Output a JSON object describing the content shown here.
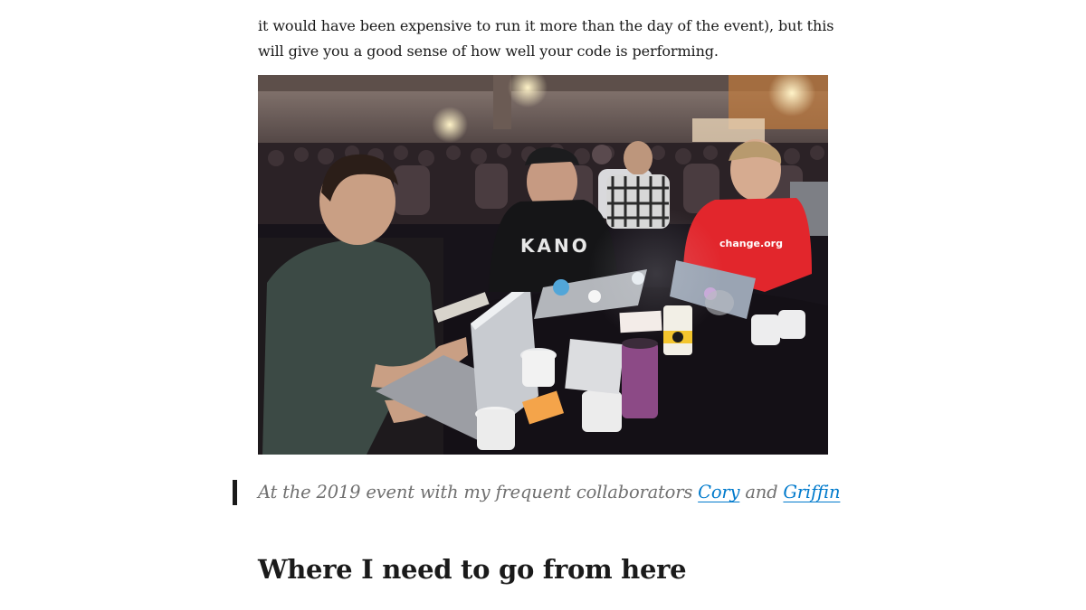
{
  "article": {
    "paragraph_lines": [
      "it would have been expensive to run it more than the day of the event), but this",
      "will give you a good sense of how well your code is performing."
    ],
    "photo": {
      "shirt_text_left": "KANO",
      "shirt_text_right": "change.org"
    },
    "caption": {
      "prefix": "At the 2019 event with my frequent collaborators ",
      "link1": "Cory",
      "middle": " and ",
      "link2": "Griffin"
    },
    "heading": "Where I need to go from here"
  },
  "colors": {
    "text": "#1a1a1a",
    "caption": "#707070",
    "link": "#007acc",
    "quote_bar": "#1a1a1a"
  }
}
